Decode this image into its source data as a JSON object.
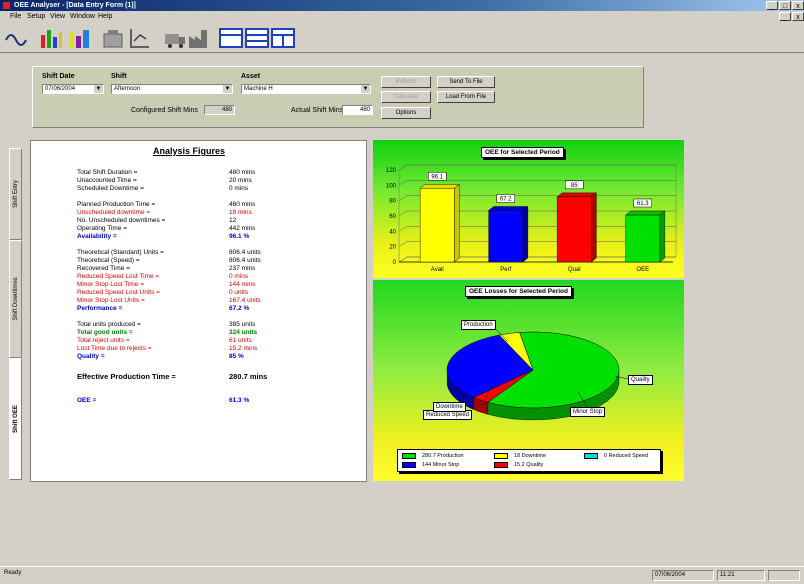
{
  "window": {
    "title": "OEE Analyser - [Data Entry Form (1)]"
  },
  "menu": [
    "File",
    "Setup",
    "View",
    "Window",
    "Help"
  ],
  "toolbar": {
    "icons": [
      "wave-icon",
      "bar-chart-icon",
      "bar-chart-alt-icon",
      "machine-icon",
      "chart-axis-icon",
      "truck-icon",
      "factory-icon",
      "layout-icon",
      "table-icon",
      "column-icon"
    ]
  },
  "selection": {
    "shift_date_label": "Shift Date",
    "shift_date_value": "07/06/2004",
    "shift_label": "Shift",
    "shift_value": "Afternoon",
    "asset_label": "Asset",
    "asset_value": "Machine H",
    "configured_shift_mins_label": "Configured Shift Mins",
    "configured_shift_mins_value": "480",
    "actual_shift_mins_label": "Actual Shift Mins",
    "actual_shift_mins_value": "480",
    "buttons": {
      "b1": "Refresh",
      "b2": "Calculate",
      "b3": "Options",
      "send_to_file": "Send To File",
      "load_from_file": "Load From File"
    }
  },
  "side_tabs": [
    "Shift Entry",
    "Shift Downtimes",
    "Shift OEE"
  ],
  "analysis": {
    "title": "Analysis Figures",
    "rows": [
      {
        "label": "Total Shift Duration =",
        "value": "480 mins",
        "style": ""
      },
      {
        "label": "Unaccounted Time =",
        "value": "20 mins",
        "style": ""
      },
      {
        "label": "Scheduled Downtime =",
        "value": "0 mins",
        "style": ""
      },
      {
        "label": "Planned Production Time =",
        "value": "460 mins",
        "style": ""
      },
      {
        "label": "Unscheduled downtime =",
        "value": "18 mins",
        "style": "red"
      },
      {
        "label": "No. Unscheduled downtimes =",
        "value": "12",
        "style": ""
      },
      {
        "label": "Operating Time =",
        "value": "442 mins",
        "style": ""
      },
      {
        "label": "Availability =",
        "value": "96.1 %",
        "style": "blue"
      },
      {
        "label": "Theoretical (Standard) Units =",
        "value": "806.4 units",
        "style": ""
      },
      {
        "label": "Theoretical (Speed) =",
        "value": "806.4 units",
        "style": ""
      },
      {
        "label": "Recovered Time =",
        "value": "237 mins",
        "style": ""
      },
      {
        "label": "Reduced Speed Lost Time =",
        "value": "0 mins",
        "style": "red"
      },
      {
        "label": "Minor Stop Lost Time =",
        "value": "144 mins",
        "style": "red"
      },
      {
        "label": "Reduced Speed Lost Units =",
        "value": "0 units",
        "style": "red"
      },
      {
        "label": "Minor Stop Lost Units =",
        "value": "167.4 units",
        "style": "red"
      },
      {
        "label": "Performance =",
        "value": "67.2 %",
        "style": "blue"
      },
      {
        "label": "Total units produced =",
        "value": "385 units",
        "style": ""
      },
      {
        "label": "Total good units =",
        "value": "324 units",
        "style": "green"
      },
      {
        "label": "Total reject units =",
        "value": "61 units",
        "style": "red"
      },
      {
        "label": "Lost Time due to rejects =",
        "value": "15.2 mins",
        "style": "red"
      },
      {
        "label": "Quality =",
        "value": "85 %",
        "style": "blue"
      },
      {
        "label": "Effective Production Time =",
        "value": "280.7 mins",
        "style": "bold"
      },
      {
        "label": "OEE =",
        "value": "61.3 %",
        "style": "blue"
      }
    ]
  },
  "chart_data": [
    {
      "type": "bar",
      "title": "OEE for Selected Period",
      "categories": [
        "Avail",
        "Perf",
        "Qual",
        "OEE"
      ],
      "values": [
        96.1,
        67.2,
        85,
        61.3
      ],
      "colors": [
        "#ffff00",
        "#0000ff",
        "#ff0000",
        "#00e000"
      ],
      "value_labels": [
        "96.1",
        "67.2",
        "85",
        "61.3"
      ],
      "ylim": [
        0,
        120
      ],
      "yticks": [
        "0",
        "20",
        "40",
        "60",
        "80",
        "100",
        "120"
      ],
      "grid": true
    },
    {
      "type": "pie",
      "title": "OEE Losses for Selected Period",
      "labels": [
        "Production",
        "Quality",
        "Minor Stop",
        "Reduced Speed",
        "Downtime"
      ],
      "values": [
        280.7,
        15.2,
        144,
        0,
        18
      ],
      "colors": [
        "#00e000",
        "#ff0000",
        "#0000ff",
        "#00e0e0",
        "#ffff00"
      ],
      "legend": [
        {
          "text": "280.7 Production",
          "color": "#00e000"
        },
        {
          "text": "18 Downtime",
          "color": "#ffff00"
        },
        {
          "text": "0 Reduced Speed",
          "color": "#00e0e0"
        },
        {
          "text": "144 Minor Stop",
          "color": "#0000ff"
        },
        {
          "text": "15.2 Quality",
          "color": "#ff0000"
        }
      ],
      "legend_position": "bottom"
    }
  ],
  "status": {
    "left": "Ready",
    "date": "07/06/2004",
    "time": "11:21"
  }
}
